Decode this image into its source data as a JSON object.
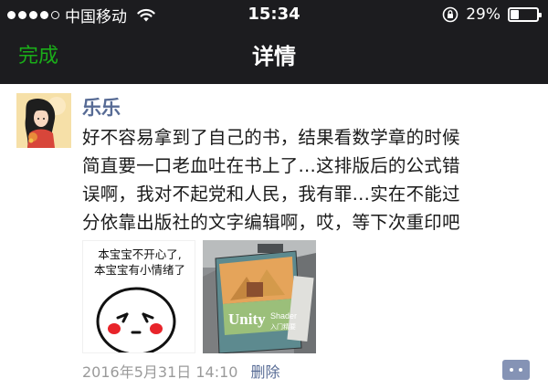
{
  "status_bar": {
    "carrier": "中国移动",
    "time": "15:34",
    "battery_text": "29%",
    "battery_level": 0.29,
    "signal_bars": 4,
    "icons": [
      "signal-dots-icon",
      "wifi-icon",
      "rotation-lock-icon",
      "battery-icon"
    ]
  },
  "nav": {
    "done_label": "完成",
    "title": "详情"
  },
  "post": {
    "username": "乐乐",
    "text": "好不容易拿到了自己的书，结果看数学章的时候\n简直要一口老血吐在书上了…这排版后的公式错\n误啊，我对不起党和人民，我有罪…实在不能过\n分依靠出版社的文字编辑啊，哎，等下次重印吧",
    "images": [
      {
        "type": "meme",
        "line1": "本宝宝不开心了,",
        "line2": "本宝宝有小情绪了"
      },
      {
        "type": "book-photo",
        "cover_title": "Unity",
        "cover_subtitle": "Shader",
        "cover_tag": "入门精要"
      }
    ],
    "timestamp": "2016年5月31日 14:10",
    "delete_label": "删除"
  },
  "colors": {
    "bar_bg": "#1c1c1f",
    "accent_green": "#1aad19",
    "link_blue": "#576b95",
    "meta_gray": "#9a9a9a",
    "comment_btn": "#8593b5"
  }
}
